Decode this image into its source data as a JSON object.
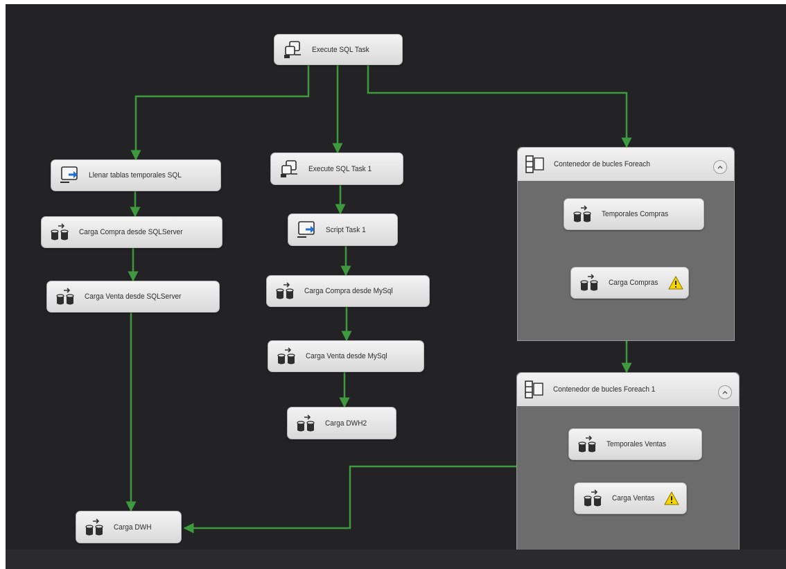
{
  "tasks": {
    "execute_sql_task": {
      "label": "Execute SQL Task",
      "icon": "execute-sql-icon"
    },
    "llenar_tablas": {
      "label": "Llenar tablas temporales SQL",
      "icon": "script-task-icon"
    },
    "execute_sql_task_1": {
      "label": "Execute SQL Task 1",
      "icon": "execute-sql-icon"
    },
    "carga_compra_sqlserver": {
      "label": "Carga Compra desde SQLServer",
      "icon": "data-flow-icon"
    },
    "script_task_1": {
      "label": "Script Task 1",
      "icon": "script-task-icon"
    },
    "carga_venta_sqlserver": {
      "label": "Carga Venta desde SQLServer",
      "icon": "data-flow-icon"
    },
    "carga_compra_mysql": {
      "label": "Carga Compra desde MySql",
      "icon": "data-flow-icon"
    },
    "carga_venta_mysql": {
      "label": "Carga Venta desde MySql",
      "icon": "data-flow-icon"
    },
    "carga_dwh2": {
      "label": "Carga DWH2",
      "icon": "data-flow-icon"
    },
    "carga_dwh": {
      "label": "Carga DWH",
      "icon": "data-flow-icon"
    }
  },
  "containers": {
    "foreach": {
      "label": "Contenedor de bucles Foreach",
      "icon": "foreach-loop-icon",
      "tasks": {
        "temporales_compras": {
          "label": "Temporales Compras",
          "icon": "data-flow-icon",
          "warning": false
        },
        "carga_compras": {
          "label": "Carga Compras",
          "icon": "data-flow-icon",
          "warning": true
        }
      }
    },
    "foreach_1": {
      "label": "Contenedor de bucles Foreach 1",
      "icon": "foreach-loop-icon",
      "tasks": {
        "temporales_ventas": {
          "label": "Temporales Ventas",
          "icon": "data-flow-icon",
          "warning": false
        },
        "carga_ventas": {
          "label": "Carga Ventas",
          "icon": "data-flow-icon",
          "warning": true
        }
      }
    }
  },
  "colors": {
    "canvas": "#232326",
    "precedence_success": "#3f9a3f",
    "container_body": "#6c6c6c",
    "warning": "#f5d400"
  }
}
